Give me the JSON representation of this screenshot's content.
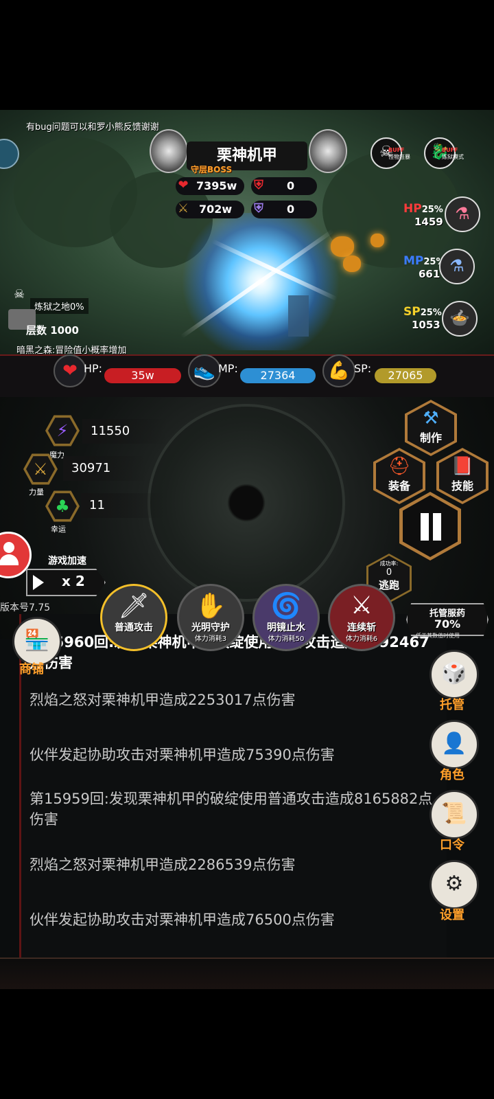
{
  "header_note": "有bug问题可以和罗小熊反馈谢谢",
  "boss": {
    "name": "栗神机甲",
    "tag": "守层BOSS",
    "hp": "7395w",
    "def": "0",
    "atk": "702w",
    "res": "0"
  },
  "buffs": [
    {
      "tag": "BUFF",
      "label": "怪物狂暴"
    },
    {
      "tag": "BUFF",
      "label": "炼狱模式"
    }
  ],
  "potions": [
    {
      "type": "HP",
      "pct": "25%",
      "value": "1459",
      "color": "#ff3b3b"
    },
    {
      "type": "MP",
      "pct": "25%",
      "value": "661",
      "color": "#3b7bff"
    },
    {
      "type": "SP",
      "pct": "25%",
      "value": "1053",
      "color": "#f4d02a"
    }
  ],
  "floor": {
    "region": "炼狱之地0%",
    "label": "层数",
    "value": "1000",
    "note": "暗黑之森:冒险值小概率增加"
  },
  "player": {
    "hp_label": "HP:",
    "hp": "35w",
    "mp_label": "MP:",
    "mp": "27364",
    "sp_label": "SP:",
    "sp": "27065"
  },
  "attributes": [
    {
      "label": "魔力",
      "value": "11550",
      "icon": "lightning-icon"
    },
    {
      "label": "力量",
      "value": "30971",
      "icon": "sword-icon"
    },
    {
      "label": "幸运",
      "value": "11",
      "icon": "clover-icon"
    }
  ],
  "speed": {
    "label": "游戏加速",
    "value": "x 2"
  },
  "version": "版本号7.75",
  "actions": {
    "craft": "制作",
    "equip": "装备",
    "skill": "技能"
  },
  "escape": {
    "rate_label": "成功率:",
    "rate": "0",
    "label": "逃跑"
  },
  "auto_potion": {
    "title": "托管服药",
    "pct": "70%",
    "note": "低于其数值时使用"
  },
  "skills": [
    {
      "name": "普通攻击",
      "cost": ""
    },
    {
      "name": "光明守护",
      "cost": "体力消耗3"
    },
    {
      "name": "明镜止水",
      "cost": "体力消耗50"
    },
    {
      "name": "连续斩",
      "cost": "体力消耗6"
    }
  ],
  "shop": "商铺",
  "log": [
    "第15960回:发现栗神机甲的破绽使用普通攻击造成8792467点伤害",
    "烈焰之怒对栗神机甲造成2253017点伤害",
    "伙伴发起协助攻击对栗神机甲造成75390点伤害",
    "第15959回:发现栗神机甲的破绽使用普通攻击造成8165882点伤害",
    "烈焰之怒对栗神机甲造成2286539点伤害",
    "伙伴发起协助攻击对栗神机甲造成76500点伤害"
  ],
  "side_menu": [
    {
      "label": "托管",
      "icon": "dice-icon"
    },
    {
      "label": "角色",
      "icon": "hooded-figure-icon"
    },
    {
      "label": "口令",
      "icon": "scroll-icon"
    },
    {
      "label": "设置",
      "icon": "gear-icon"
    }
  ]
}
